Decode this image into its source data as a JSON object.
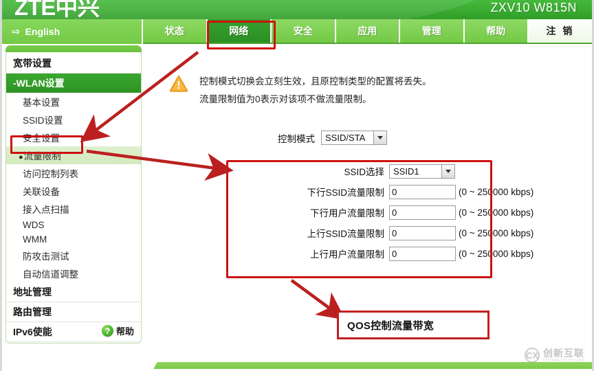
{
  "header": {
    "brand": "ZTE中兴",
    "model": "ZXV10 W815N"
  },
  "nav": {
    "language_label": "English",
    "language_icon": "arrow-right-icon",
    "tabs": [
      {
        "label": "状态",
        "active": false
      },
      {
        "label": "网络",
        "active": true
      },
      {
        "label": "安全",
        "active": false
      },
      {
        "label": "应用",
        "active": false
      },
      {
        "label": "管理",
        "active": false
      },
      {
        "label": "帮助",
        "active": false
      }
    ],
    "logout_label": "注 销"
  },
  "sidebar": {
    "items": [
      {
        "label": "宽带设置",
        "type": "group",
        "state": "normal"
      },
      {
        "label": "-WLAN设置",
        "type": "group",
        "state": "active"
      },
      {
        "label": "基本设置",
        "type": "sub",
        "state": "normal"
      },
      {
        "label": "SSID设置",
        "type": "sub",
        "state": "normal"
      },
      {
        "label": "安全设置",
        "type": "sub",
        "state": "normal"
      },
      {
        "label": "流量限制",
        "type": "sub",
        "state": "selected",
        "bullet": "●"
      },
      {
        "label": "访问控制列表",
        "type": "sub",
        "state": "normal"
      },
      {
        "label": "关联设备",
        "type": "sub",
        "state": "normal"
      },
      {
        "label": "接入点扫描",
        "type": "sub",
        "state": "normal"
      },
      {
        "label": "WDS",
        "type": "sub",
        "state": "normal"
      },
      {
        "label": "WMM",
        "type": "sub",
        "state": "normal"
      },
      {
        "label": "防攻击测试",
        "type": "sub",
        "state": "normal"
      },
      {
        "label": "自动信道调整",
        "type": "sub",
        "state": "normal"
      },
      {
        "label": "地址管理",
        "type": "group",
        "state": "normal"
      },
      {
        "label": "路由管理",
        "type": "group",
        "state": "normal"
      },
      {
        "label": "IPv6使能",
        "type": "group",
        "state": "normal"
      }
    ],
    "help": {
      "label": "帮助",
      "icon": "question-mark-icon",
      "glyph": "?"
    }
  },
  "main": {
    "notice": {
      "icon": "warning-triangle-icon",
      "line1": "控制模式切换会立刻生效，且原控制类型的配置将丢失。",
      "line2": "流量限制值为0表示对该项不做流量限制。"
    },
    "control_mode": {
      "label": "控制模式",
      "value": "SSID/STA",
      "caret_icon": "chevron-down-icon"
    },
    "ssid_select": {
      "label": "SSID选择",
      "value": "SSID1",
      "caret_icon": "chevron-down-icon"
    },
    "limits": [
      {
        "label": "下行SSID流量限制",
        "value": "0",
        "hint": "(0 ~ 250000 kbps)"
      },
      {
        "label": "下行用户流量限制",
        "value": "0",
        "hint": "(0 ~ 250000 kbps)"
      },
      {
        "label": "上行SSID流量限制",
        "value": "0",
        "hint": "(0 ~ 250000 kbps)"
      },
      {
        "label": "上行用户流量限制",
        "value": "0",
        "hint": "(0 ~ 250000 kbps)"
      }
    ]
  },
  "annotations": {
    "callout_text": "QOS控制流量带宽",
    "box_color": "#c21f1f",
    "arrow_color": "#bb2020"
  },
  "watermark": {
    "cn": "创新互联",
    "en": "CHUANGXIN HULIAN",
    "mark": "CX"
  },
  "colors": {
    "brand_green": "#3cae33",
    "nav_green": "#7ecf4f",
    "active_tab": "#2f9c28",
    "selected_row": "#d8edc6",
    "warning_orange": "#f0a22a",
    "annotation_red": "#c21f1f"
  }
}
